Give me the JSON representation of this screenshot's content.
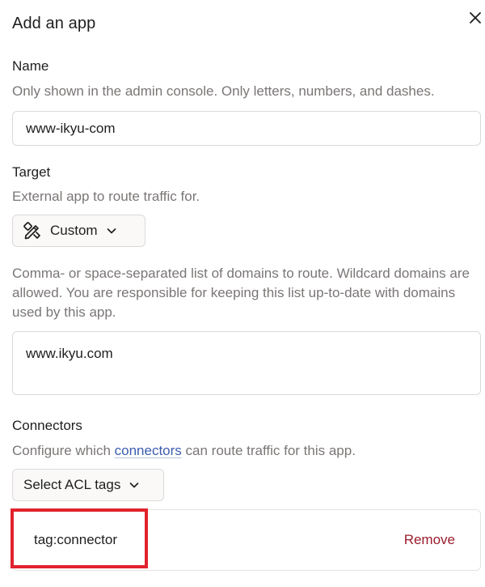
{
  "dialog": {
    "title": "Add an app",
    "close_icon": "close-icon"
  },
  "name_section": {
    "label": "Name",
    "description": "Only shown in the admin console. Only letters, numbers, and dashes.",
    "value": "www-ikyu-com"
  },
  "target_section": {
    "label": "Target",
    "description": "External app to route traffic for.",
    "button_label": "Custom",
    "icon": "custom-tools-icon"
  },
  "domains_section": {
    "description": "Comma- or space-separated list of domains to route. Wildcard domains are allowed. You are responsible for keeping this list up-to-date with domains used by this app.",
    "value": "www.ikyu.com"
  },
  "connectors_section": {
    "label": "Connectors",
    "description_before": "Configure which ",
    "description_link": "connectors",
    "description_after": " can route traffic for this app.",
    "acl_button_label": "Select ACL tags",
    "tags": [
      {
        "name": "tag:connector",
        "remove_label": "Remove"
      }
    ]
  },
  "colors": {
    "remove": "#9b1c2c",
    "link": "#3b5cad",
    "highlight": "#e1232d"
  }
}
